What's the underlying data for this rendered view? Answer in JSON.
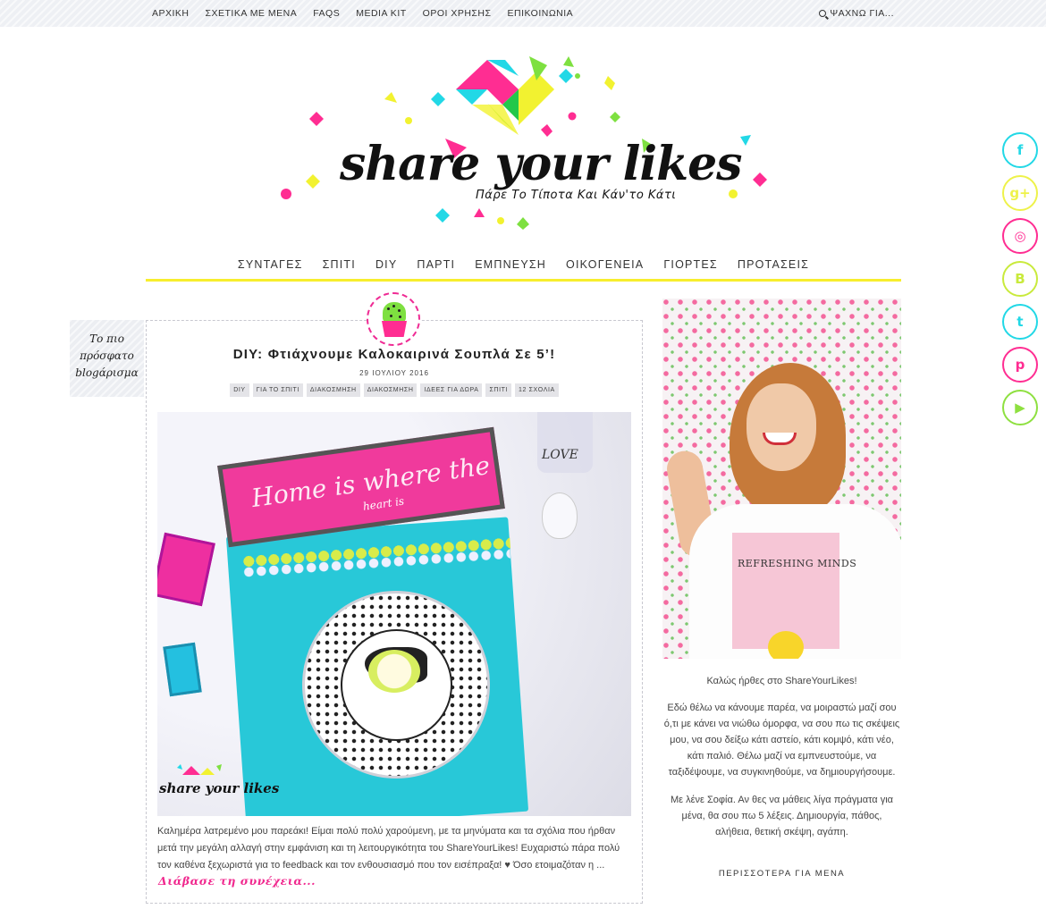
{
  "top_nav": {
    "items": [
      "ΑΡΧΙΚΗ",
      "ΣΧΕΤΙΚΑ ΜΕ ΜΕΝΑ",
      "FAQS",
      "MEDIA KIT",
      "ΟΡΟΙ ΧΡΗΣΗΣ",
      "ΕΠΙΚΟΙΝΩΝΙΑ"
    ],
    "search_label": "ΨΑΧΝΩ ΓΙΑ..."
  },
  "logo": {
    "title": "share your likes",
    "tagline": "Πάρε Το Τίποτα Και Κάν'το Κάτι",
    "colors": {
      "pink": "#ff2d92",
      "green": "#7ee040",
      "cyan": "#22d8e6",
      "yellow": "#f2f230",
      "black": "#111111"
    }
  },
  "main_nav": {
    "items": [
      "ΣΥΝΤΑΓΕΣ",
      "ΣΠΙΤΙ",
      "DIY",
      "ΠΑΡΤΙ",
      "ΕΜΠΝΕΥΣΗ",
      "ΟΙΚΟΓΕΝΕΙΑ",
      "ΓΙΟΡΤΕΣ",
      "ΠΡΟΤΑΣΕΙΣ"
    ],
    "underline_color": "#f7ee2e"
  },
  "latest_label": {
    "line1": "Το πιο",
    "line2": "πρόσφατο",
    "line3": "blogάρισμα"
  },
  "post": {
    "badge_icon": "cactus-icon",
    "title": "DIY: Φτιάχνουμε Καλοκαιρινά Σουπλά Σε 5’!",
    "date": "29 ΙΟΥΛΙΟΥ 2016",
    "tags": [
      "DIY",
      "ΓΙΑ ΤΟ ΣΠΙΤΙ",
      "ΔΙΑΚΟΣΜΗΣΗ",
      "ΔΙΑΚΟΣΜΗΣΗ",
      "ΙΔΕΕΣ ΓΙΑ ΔΩΡΑ",
      "ΣΠΙΤΙ",
      "12 ΣΧΟΛΙΑ"
    ],
    "image": {
      "sign_text": "Home is where the",
      "sign_subtext": "heart is",
      "glass_text": "LOVE",
      "watermark": "share your likes"
    },
    "excerpt": "Καλημέρα λατρεμένο μου παρεάκι! Είμαι πολύ πολύ χαρούμενη, με τα μηνύματα και τα σχόλια που ήρθαν μετά την μεγάλη αλλαγή στην εμφάνιση και τη λειτουργικότητα του ShareYourLikes! Ευχαριστώ πάρα πολύ τον καθένα ξεχωριστά για το feedback και τον ενθουσιασμό που τον εισέπραξα! ♥ Όσο ετοιμαζόταν η ...",
    "read_more": "Διάβασε τη συνέχεια..."
  },
  "sidebar": {
    "shirt_text": "REFRESHING MINDS",
    "welcome": "Καλώς ήρθες στο ShareYourLikes!",
    "para1": "Εδώ θέλω να κάνουμε παρέα, να μοιραστώ μαζί σου ό,τι με κάνει να νιώθω όμορφα, να σου πω τις σκέψεις μου, να σου δείξω κάτι αστείο, κάτι κομψό, κάτι νέο, κάτι παλιό. Θέλω μαζί να εμπνευστούμε, να ταξιδέψουμε, να συγκινηθούμε, να δημιουργήσουμε.",
    "para2": "Με λένε Σοφία. Αν θες να μάθεις λίγα πράγματα για μένα, θα σου πω 5 λέξεις. Δημιουργία, πάθος, αλήθεια, θετική σκέψη, αγάπη.",
    "more_link": "ΠΕΡΙΣΣΟΤΕΡΑ ΓΙΑ ΜΕΝΑ"
  },
  "social": [
    {
      "icon": "facebook-icon",
      "glyph": "f",
      "color": "#22d8e6"
    },
    {
      "icon": "google-plus-icon",
      "glyph": "g+",
      "color": "#eef24a"
    },
    {
      "icon": "instagram-icon",
      "glyph": "◎",
      "color": "#ff2d92"
    },
    {
      "icon": "blogger-icon",
      "glyph": "B",
      "color": "#c9ea3c"
    },
    {
      "icon": "twitter-icon",
      "glyph": "t",
      "color": "#22d8e6"
    },
    {
      "icon": "pinterest-icon",
      "glyph": "p",
      "color": "#ff2d92"
    },
    {
      "icon": "youtube-icon",
      "glyph": "▶",
      "color": "#8ee040"
    }
  ]
}
